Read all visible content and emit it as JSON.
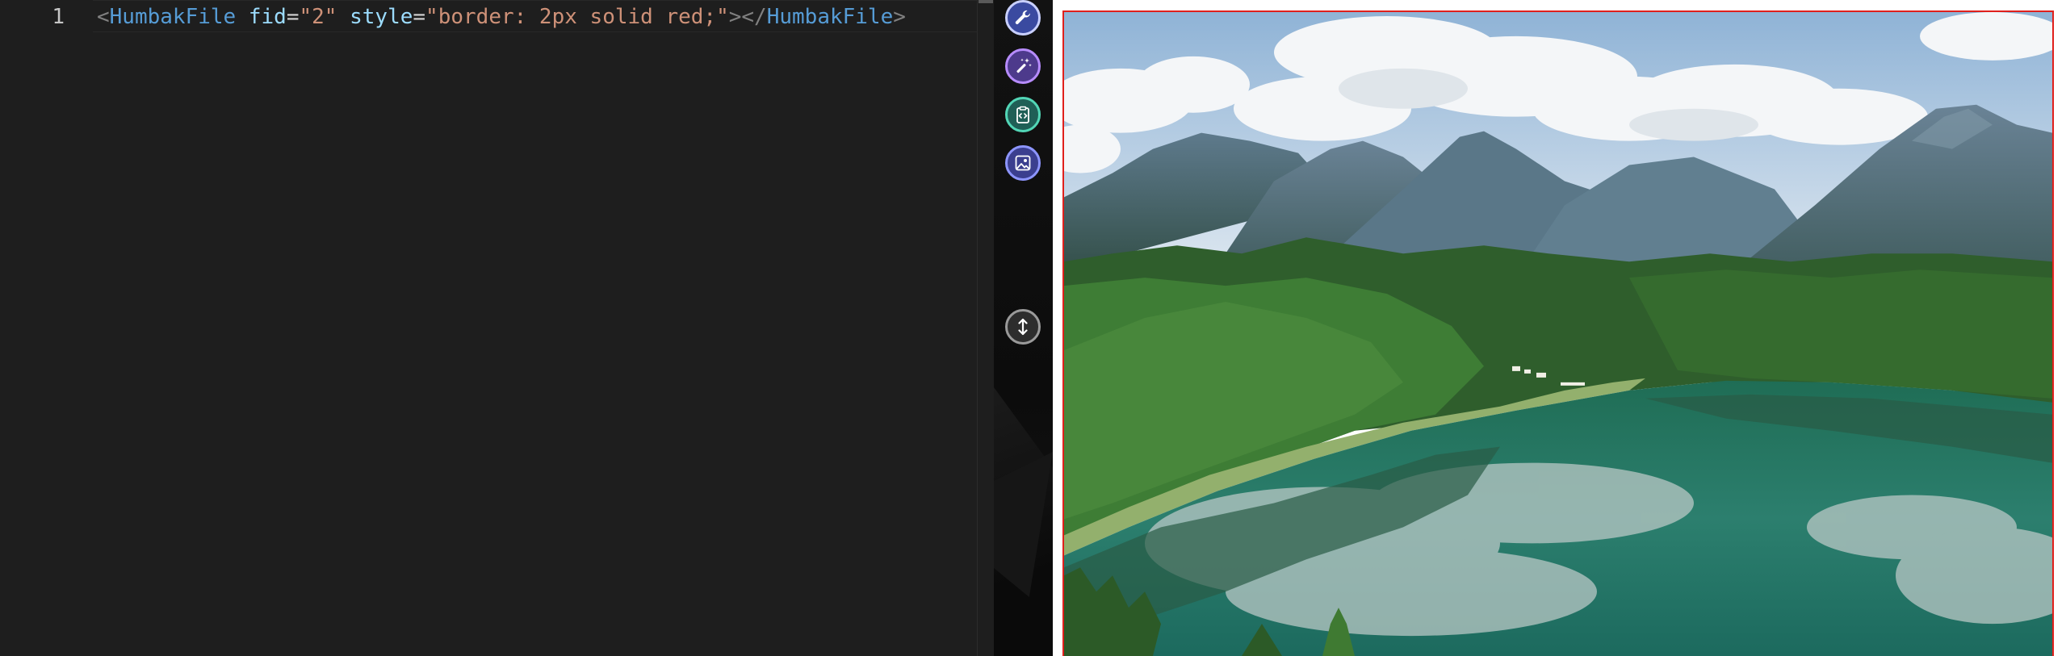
{
  "editor": {
    "line_number": "1",
    "tokens": {
      "open_bracket": "<",
      "tag": "HumbakFile",
      "space1": " ",
      "attr1": "fid",
      "eq1": "=",
      "val1": "\"2\"",
      "space2": " ",
      "attr2": "style",
      "eq2": "=",
      "val2": "\"border: 2px solid red;\"",
      "close_open": ">",
      "end_open": "</",
      "end_tag": "HumbakFile",
      "end_close": ">"
    }
  },
  "toolbar": {
    "buttons": [
      {
        "name": "wrench",
        "icon": "wrench-icon"
      },
      {
        "name": "magic-wand",
        "icon": "magic-wand-icon"
      },
      {
        "name": "clipboard-code",
        "icon": "clipboard-code-icon"
      },
      {
        "name": "image",
        "icon": "image-icon"
      },
      {
        "name": "resize-vertical",
        "icon": "vertical-resize-icon"
      }
    ]
  },
  "preview": {
    "image_subject": "mountain lake landscape",
    "border_color": "#e0201c"
  },
  "colors": {
    "editor_bg": "#1e1e1e",
    "tag": "#569cd6",
    "attribute": "#9cdcfe",
    "string": "#ce9178",
    "punctuation": "#808080"
  }
}
